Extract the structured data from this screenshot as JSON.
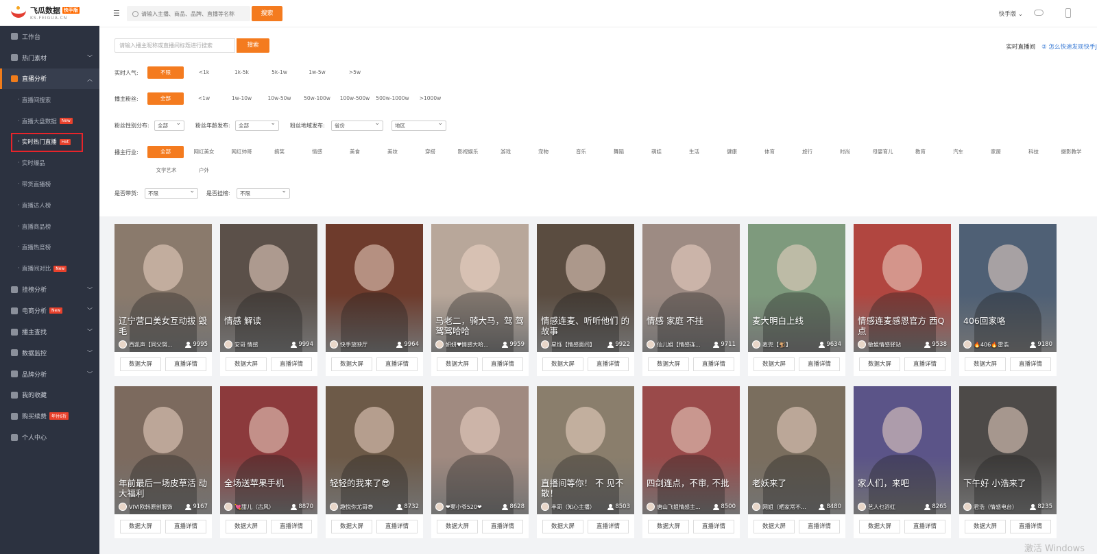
{
  "brand": {
    "name": "飞瓜数据",
    "edition": "快手版",
    "domain": "KS.FEIGUA.CN"
  },
  "sidebar": {
    "items": [
      {
        "label": "工作台",
        "icon": "home-icon",
        "chevron": false
      },
      {
        "label": "热门素材",
        "icon": "fire-icon",
        "chevron": true
      },
      {
        "label": "直播分析",
        "icon": "bar-chart-icon",
        "chevron": true,
        "active": true
      }
    ],
    "sub_items": [
      {
        "label": "直播间搜索",
        "badge": ""
      },
      {
        "label": "直播大盘数据",
        "badge": "New"
      },
      {
        "label": "实时热门直播",
        "badge": "Hot",
        "current": true
      },
      {
        "label": "实时爆品",
        "badge": ""
      },
      {
        "label": "带货直播榜",
        "badge": ""
      },
      {
        "label": "直播达人榜",
        "badge": ""
      },
      {
        "label": "直播商品榜",
        "badge": ""
      },
      {
        "label": "直播热度榜",
        "badge": ""
      },
      {
        "label": "直播间对比",
        "badge": "New"
      }
    ],
    "bottom_items": [
      {
        "label": "挂榜分析",
        "icon": "chart-icon",
        "chevron": true,
        "badge": ""
      },
      {
        "label": "电商分析",
        "icon": "shop-icon",
        "chevron": true,
        "badge": "New"
      },
      {
        "label": "播主查找",
        "icon": "search-icon",
        "chevron": true,
        "badge": ""
      },
      {
        "label": "数据监控",
        "icon": "monitor-icon",
        "chevron": true,
        "badge": ""
      },
      {
        "label": "品牌分析",
        "icon": "brand-icon",
        "chevron": true,
        "badge": ""
      },
      {
        "label": "我的收藏",
        "icon": "collect-icon",
        "chevron": false,
        "badge": ""
      },
      {
        "label": "购买续费",
        "icon": "cart-icon",
        "chevron": false,
        "badge": "年付6折"
      },
      {
        "label": "个人中心",
        "icon": "user-icon",
        "chevron": false,
        "badge": ""
      }
    ]
  },
  "topbar": {
    "search_placeholder": "请输入主播、商品、品牌、直播等名称",
    "search_button": "搜索",
    "platform": "快手版 ⌄"
  },
  "filters": {
    "search_placeholder": "请输入播主昵称或直播间标题进行搜索",
    "search_button": "搜索",
    "live_room": "实时直播间",
    "help": "② 怎么快速发现快手J",
    "popularity": {
      "label": "实时人气:",
      "options": [
        "不限",
        "<1k",
        "1k-5k",
        "5k-1w",
        "1w-5w",
        ">5w"
      ]
    },
    "fans": {
      "label": "播主粉丝:",
      "options": [
        "全部",
        "<1w",
        "1w-10w",
        "10w-50w",
        "50w-100w",
        "100w-500w",
        "500w-1000w",
        ">1000w"
      ]
    },
    "fan_gender": {
      "label": "粉丝性别分布:",
      "value": "全部"
    },
    "fan_age": {
      "label": "粉丝年龄发布:",
      "value": "全部"
    },
    "fan_region": {
      "label": "粉丝地域发布:",
      "province": "省份",
      "region": "地区"
    },
    "industry": {
      "label": "播主行业:",
      "options": [
        "全部",
        "网红美女",
        "网红帅哥",
        "搞笑",
        "情感",
        "美食",
        "美妆",
        "穿搭",
        "影视娱乐",
        "游戏",
        "宠物",
        "音乐",
        "舞蹈",
        "萌娃",
        "生活",
        "健康",
        "体育",
        "旅行",
        "时尚",
        "母婴育儿",
        "教育",
        "汽车",
        "家居",
        "科技",
        "摄影教学"
      ],
      "options2": [
        "文学艺术",
        "户外"
      ]
    },
    "with_goods": {
      "label": "是否带货:",
      "value": "不限"
    },
    "on_rank": {
      "label": "是否挂榜:",
      "value": "不限"
    }
  },
  "card_buttons": {
    "screen": "数据大屏",
    "detail": "直播详情"
  },
  "cards": [
    {
      "title": "辽宁营口美女互动拔 毁毛",
      "anchor": "西凯声【同父努...",
      "viewers": "9995",
      "bg": "#8a7a6c"
    },
    {
      "title": "情感 解读",
      "anchor": "安哥 情感",
      "viewers": "9994",
      "bg": "#5b5049"
    },
    {
      "title": "",
      "anchor": "快手放映厅",
      "viewers": "9964",
      "bg": "#6e3b2c"
    },
    {
      "title": "马老二，骑大马，驾 驾驾驾哈哈",
      "anchor": "妍妍♥情感大哈...",
      "viewers": "9959",
      "bg": "#b8a79a"
    },
    {
      "title": "情感连麦、听听他们 的故事",
      "anchor": "星烁【情感面间】",
      "viewers": "9922",
      "bg": "#5a4c40"
    },
    {
      "title": "情感 家庭 不挂",
      "anchor": "仙儿姐【情感连...",
      "viewers": "9711",
      "bg": "#9d8b83"
    },
    {
      "title": "麦大明白上线",
      "anchor": "麦兜【🐒】",
      "viewers": "9634",
      "bg": "#7e9a7d"
    },
    {
      "title": "情感连麦感恩官方 西Q点",
      "anchor": "敏姐情感驿站",
      "viewers": "9538",
      "bg": "#b14640"
    },
    {
      "title": "406回家咯",
      "anchor": "🔥406🔥雷浩",
      "viewers": "9180",
      "bg": "#4f6075"
    },
    {
      "title": "年前最后一场皮草活 动大福利",
      "anchor": "VIVI欧韩原创服饰",
      "viewers": "9167",
      "bg": "#7c6a5e"
    },
    {
      "title": "全场送苹果手机",
      "anchor": "💘甜儿（古风）",
      "viewers": "8870",
      "bg": "#8c3a3c"
    },
    {
      "title": "轻轻的我来了😎",
      "anchor": "趣悦你尤哥😎",
      "viewers": "8732",
      "bg": "#6d5a48"
    },
    {
      "title": "",
      "anchor": "❤窦小爷520❤",
      "viewers": "8628",
      "bg": "#a08a80"
    },
    {
      "title": "直播间等你！ 不 见不散！",
      "anchor": "丰哥（知心主播）",
      "viewers": "8503",
      "bg": "#8a7e6c"
    },
    {
      "title": "四剑连点，不审, 不批",
      "anchor": "唐山飞姐情感主...",
      "viewers": "8500",
      "bg": "#9a4a4a"
    },
    {
      "title": "老妖来了",
      "anchor": "网姐（晒家常不...",
      "viewers": "8480",
      "bg": "#7a6e5e"
    },
    {
      "title": "家人们，来吧",
      "anchor": "艺人乜浴红",
      "viewers": "8265",
      "bg": "#5b5488"
    },
    {
      "title": "下午好 小浩来了",
      "anchor": "君浩（情感电台）",
      "viewers": "8235",
      "bg": "#4d4a48"
    }
  ],
  "watermark": "激活 Windows"
}
